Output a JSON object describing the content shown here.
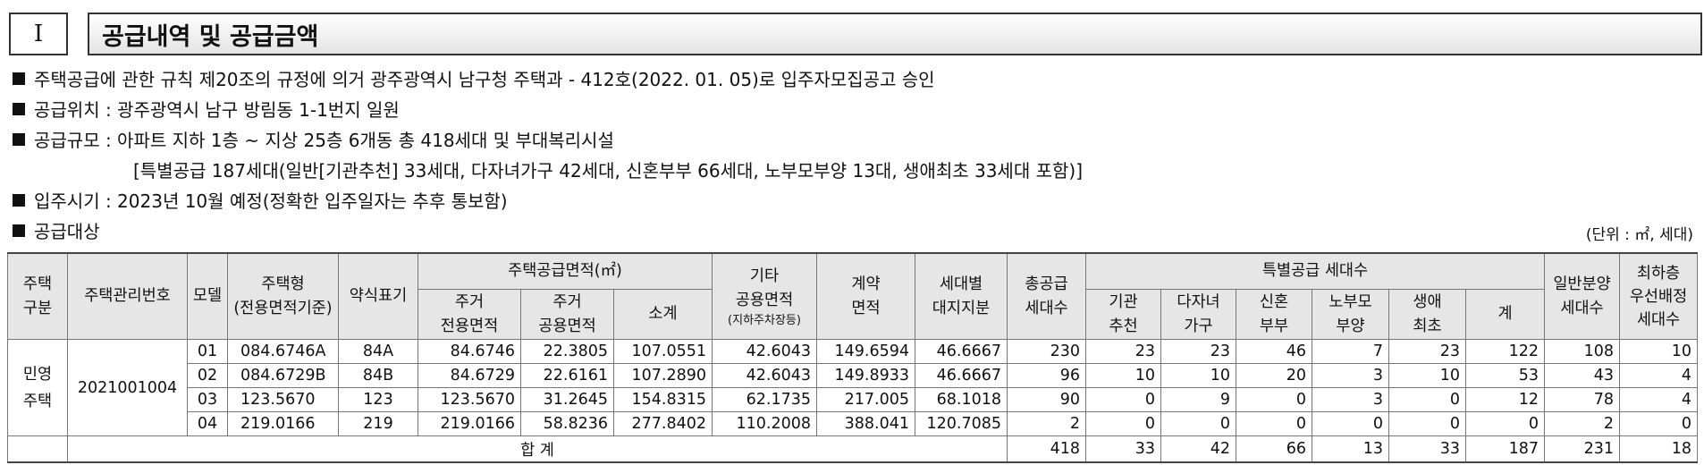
{
  "section": {
    "number": "I",
    "title": "공급내역 및 공급금액"
  },
  "notes": [
    "주택공급에 관한 규칙 제20조의 규정에 의거 광주광역시 남구청 주택과 - 412호(2022. 01. 05)로 입주자모집공고 승인",
    "공급위치 : 광주광역시 남구 방림동 1-1번지 일원",
    "공급규모 : 아파트 지하 1층 ~ 지상 25층 6개동 총 418세대 및 부대복리시설"
  ],
  "note_sub": "[특별공급 187세대(일반[기관추천] 33세대, 다자녀가구 42세대, 신혼부부 66세대, 노부모부양 13대, 생애최초 33세대 포함)]",
  "note_move_in": "입주시기 : 2023년 10월 예정(정확한 입주일자는 추후 통보함)",
  "target_label": "공급대상",
  "unit": "(단위 : ㎡, 세대)",
  "headers": {
    "housing_type": "주택\n구분",
    "management_no": "주택관리번호",
    "model": "모델",
    "housing_form": "주택형\n(전용면적기준)",
    "abbrev": "약식표기",
    "supply_area": "주택공급면적(㎡)",
    "exclusive_area": "주거\n전용면적",
    "common_area": "주거\n공용면적",
    "subtotal": "소계",
    "other_common": "기타\n공용면적",
    "other_common_note": "(지하주차장등)",
    "contract_area": "계약\n면적",
    "land_share": "세대별\n대지지분",
    "total_supply": "총공급\n세대수",
    "special_supply": "특별공급 세대수",
    "inst": "기관\n추천",
    "multi": "다자녀\n가구",
    "newlywed": "신혼\n부부",
    "elder": "노부모\n부양",
    "first": "생애\n최초",
    "sum": "계",
    "general": "일반분양\n세대수",
    "lowest": "최하층\n우선배정\n세대수"
  },
  "housing_type_value": "민영\n주택",
  "management_no_value": "2021001004",
  "rows": [
    {
      "model": "01",
      "type": "084.6746A",
      "abbr": "84A",
      "exclusive": "84.6746",
      "common": "22.3805",
      "subtotal": "107.0551",
      "other": "42.6043",
      "contract": "149.6594",
      "land": "46.6667",
      "total": "230",
      "inst": "23",
      "multi": "23",
      "newlywed": "46",
      "elder": "7",
      "first": "23",
      "sum": "122",
      "general": "108",
      "lowest": "10"
    },
    {
      "model": "02",
      "type": "084.6729B",
      "abbr": "84B",
      "exclusive": "84.6729",
      "common": "22.6161",
      "subtotal": "107.2890",
      "other": "42.6043",
      "contract": "149.8933",
      "land": "46.6667",
      "total": "96",
      "inst": "10",
      "multi": "10",
      "newlywed": "20",
      "elder": "3",
      "first": "10",
      "sum": "53",
      "general": "43",
      "lowest": "4"
    },
    {
      "model": "03",
      "type": "123.5670",
      "abbr": "123",
      "exclusive": "123.5670",
      "common": "31.2645",
      "subtotal": "154.8315",
      "other": "62.1735",
      "contract": "217.005",
      "land": "68.1018",
      "total": "90",
      "inst": "0",
      "multi": "9",
      "newlywed": "0",
      "elder": "3",
      "first": "0",
      "sum": "12",
      "general": "78",
      "lowest": "4"
    },
    {
      "model": "04",
      "type": "219.0166",
      "abbr": "219",
      "exclusive": "219.0166",
      "common": "58.8236",
      "subtotal": "277.8402",
      "other": "110.2008",
      "contract": "388.041",
      "land": "120.7085",
      "total": "2",
      "inst": "0",
      "multi": "0",
      "newlywed": "0",
      "elder": "0",
      "first": "0",
      "sum": "0",
      "general": "2",
      "lowest": "0"
    }
  ],
  "total_row": {
    "label": "합 계",
    "total": "418",
    "inst": "33",
    "multi": "42",
    "newlywed": "66",
    "elder": "13",
    "first": "33",
    "sum": "187",
    "general": "231",
    "lowest": "18"
  }
}
